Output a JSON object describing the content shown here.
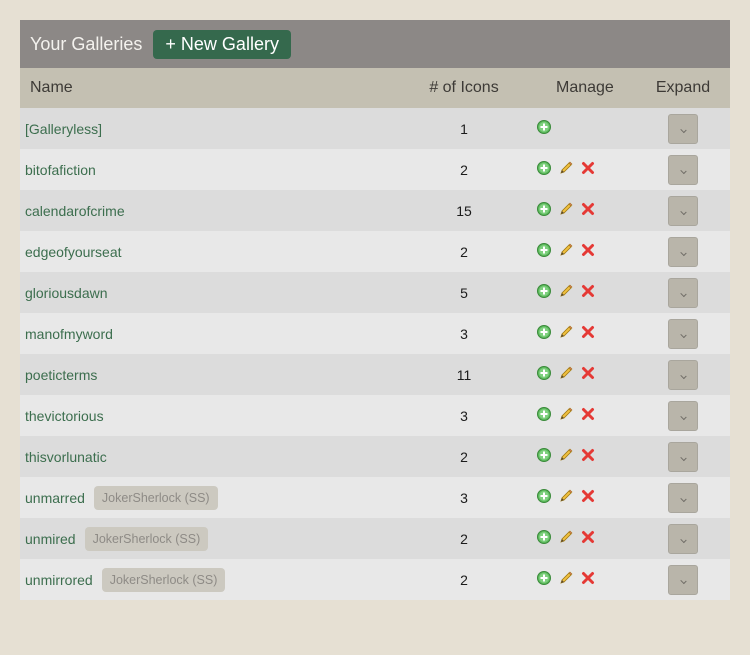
{
  "header": {
    "title": "Your Galleries",
    "new_button_label": "+ New Gallery"
  },
  "columns": {
    "name": "Name",
    "count": "# of Icons",
    "manage": "Manage",
    "expand": "Expand"
  },
  "rows": [
    {
      "name": "[Galleryless]",
      "owner": "",
      "count": "1",
      "actions": [
        "add"
      ]
    },
    {
      "name": "bitofafiction",
      "owner": "",
      "count": "2",
      "actions": [
        "add",
        "edit",
        "delete"
      ]
    },
    {
      "name": "calendarofcrime",
      "owner": "",
      "count": "15",
      "actions": [
        "add",
        "edit",
        "delete"
      ]
    },
    {
      "name": "edgeofyourseat",
      "owner": "",
      "count": "2",
      "actions": [
        "add",
        "edit",
        "delete"
      ]
    },
    {
      "name": "gloriousdawn",
      "owner": "",
      "count": "5",
      "actions": [
        "add",
        "edit",
        "delete"
      ]
    },
    {
      "name": "manofmyword",
      "owner": "",
      "count": "3",
      "actions": [
        "add",
        "edit",
        "delete"
      ]
    },
    {
      "name": "poeticterms",
      "owner": "",
      "count": "11",
      "actions": [
        "add",
        "edit",
        "delete"
      ]
    },
    {
      "name": "thevictorious",
      "owner": "",
      "count": "3",
      "actions": [
        "add",
        "edit",
        "delete"
      ]
    },
    {
      "name": "thisvorlunatic",
      "owner": "",
      "count": "2",
      "actions": [
        "add",
        "edit",
        "delete"
      ]
    },
    {
      "name": "unmarred",
      "owner": "JokerSherlock (SS)",
      "count": "3",
      "actions": [
        "add",
        "edit",
        "delete"
      ]
    },
    {
      "name": "unmired",
      "owner": "JokerSherlock (SS)",
      "count": "2",
      "actions": [
        "add",
        "edit",
        "delete"
      ]
    },
    {
      "name": "unmirrored",
      "owner": "JokerSherlock (SS)",
      "count": "2",
      "actions": [
        "add",
        "edit",
        "delete"
      ]
    }
  ],
  "icons": {
    "add": "plus-circle-icon",
    "edit": "pencil-icon",
    "delete": "x-delete-icon",
    "expand": "chevron-down-icon"
  },
  "colors": {
    "title_bar": "#8c8886",
    "new_button": "#35694d",
    "header_row": "#c4c0b2",
    "link": "#3c6e4e",
    "add_icon": "#4caf50",
    "edit_icon": "#e0b030",
    "delete_icon": "#e53935"
  }
}
